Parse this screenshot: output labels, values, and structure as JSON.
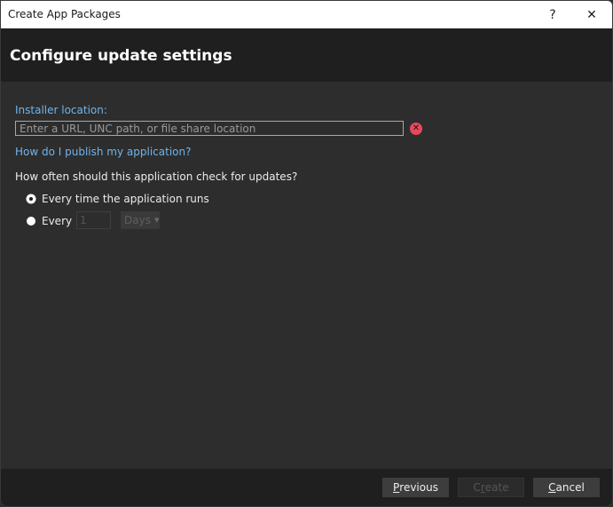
{
  "window": {
    "title": "Create App Packages",
    "help_label": "?",
    "close_label": "✕"
  },
  "header": {
    "title": "Configure update settings"
  },
  "installer": {
    "label": "Installer location:",
    "placeholder": "Enter a URL, UNC path, or file share location",
    "value": "",
    "error_icon": "✕",
    "help_link": "How do I publish my application?"
  },
  "updates": {
    "question": "How often should this application check for updates?",
    "options": [
      {
        "label": "Every time the application runs",
        "checked": true
      },
      {
        "label": "Every",
        "checked": false
      }
    ],
    "interval_value": "1",
    "interval_unit": "Days",
    "caret": "▼"
  },
  "footer": {
    "previous_first": "P",
    "previous_rest": "revious",
    "create_first": "C",
    "create_mnemonic": "r",
    "create_rest": "eate",
    "cancel_first": "C",
    "cancel_rest": "ancel"
  }
}
